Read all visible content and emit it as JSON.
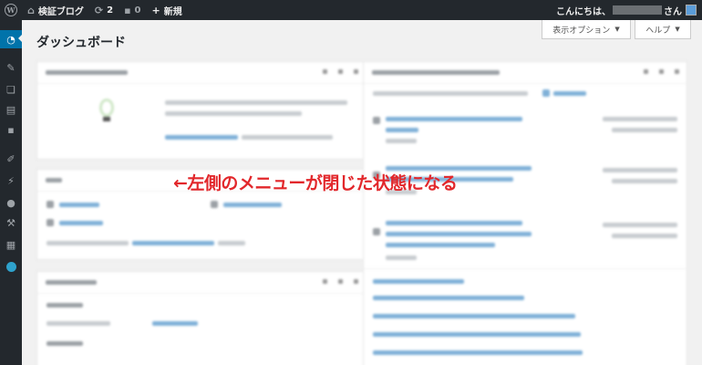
{
  "adminbar": {
    "site_name": "検証ブログ",
    "updates_count": "2",
    "comments_count": "0",
    "new_label": "新規",
    "greeting_prefix": "こんにちは、",
    "greeting_suffix": "さん"
  },
  "screen_meta": {
    "options_label": "表示オプション",
    "help_label": "ヘルプ"
  },
  "page": {
    "title": "ダッシュボード"
  },
  "annotation": {
    "text": "←左側のメニューが閉じた状態になる",
    "color": "#e2272b"
  },
  "sidebar": {
    "icons": [
      "dashboard-icon",
      "pin-icon",
      "media-icon",
      "pages-icon",
      "comments-icon",
      "appearance-icon",
      "plugins-icon",
      "users-icon",
      "tools-icon",
      "settings-icon",
      "play-icon"
    ],
    "active_color": "#0073aa"
  },
  "colors": {
    "adminbar_bg": "#23282d",
    "page_bg": "#f1f1f1",
    "accent": "#0073aa"
  }
}
